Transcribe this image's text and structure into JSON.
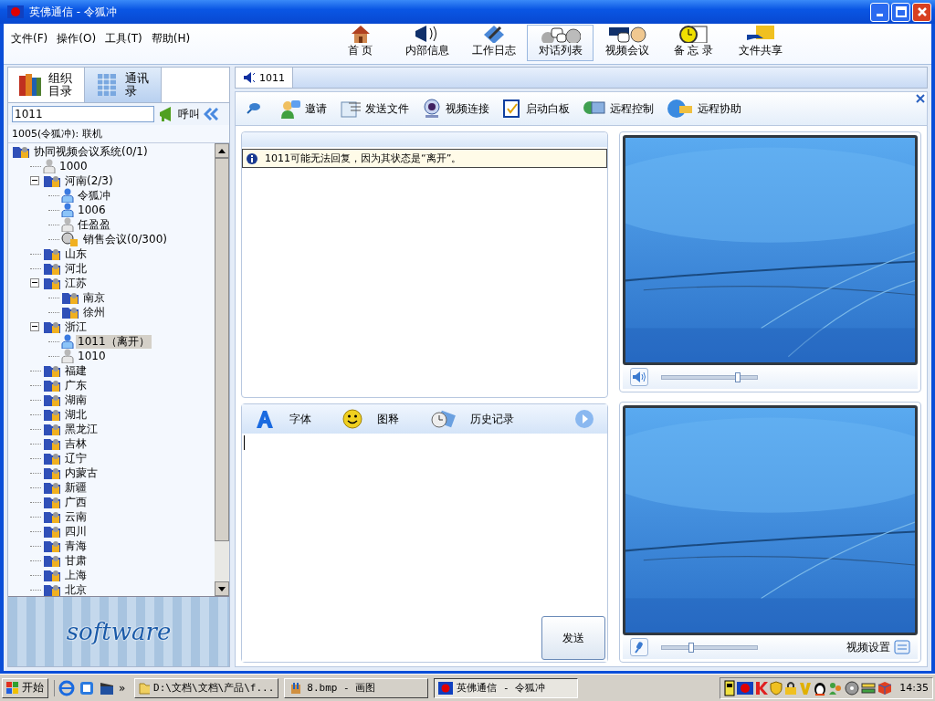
{
  "window": {
    "title": "英佛通信 - 令狐冲"
  },
  "menu": [
    "文件(F)",
    "操作(O)",
    "工具(T)",
    "帮助(H)"
  ],
  "nav": [
    {
      "label": "首 页",
      "selected": false
    },
    {
      "label": "内部信息",
      "selected": false
    },
    {
      "label": "工作日志",
      "selected": false
    },
    {
      "label": "对话列表",
      "selected": true
    },
    {
      "label": "视频会议",
      "selected": false
    },
    {
      "label": "备 忘 录",
      "selected": false
    },
    {
      "label": "文件共享",
      "selected": false
    }
  ],
  "sidebar": {
    "tabs": [
      {
        "label": "组织目录",
        "selected": true
      },
      {
        "label": "通讯录",
        "selected": false
      }
    ],
    "search": {
      "value": "1011"
    },
    "call_button": "呼叫",
    "status": "1005(令狐冲): 联机",
    "logo_text": "software"
  },
  "tree": {
    "items": [
      {
        "kind": "group",
        "label": "协同视频会议系统(0/1)",
        "selected": false,
        "children": [
          {
            "kind": "user",
            "label": "1000",
            "online": false,
            "selected": false
          },
          {
            "kind": "group",
            "label": "河南(2/3)",
            "selected": false,
            "expanded": true,
            "children": [
              {
                "kind": "user",
                "label": "令狐冲",
                "online": true,
                "selected": false
              },
              {
                "kind": "user",
                "label": "1006",
                "online": true,
                "selected": false
              },
              {
                "kind": "user",
                "label": "任盈盈",
                "online": false,
                "selected": false
              },
              {
                "kind": "meeting",
                "label": "销售会议(0/300)",
                "selected": false
              }
            ]
          },
          {
            "kind": "group",
            "label": "山东",
            "selected": false
          },
          {
            "kind": "group",
            "label": "河北",
            "selected": false
          },
          {
            "kind": "group",
            "label": "江苏",
            "selected": false,
            "expanded": true,
            "children": [
              {
                "kind": "group",
                "label": "南京",
                "selected": false
              },
              {
                "kind": "group",
                "label": "徐州",
                "selected": false
              }
            ]
          },
          {
            "kind": "group",
            "label": "浙江",
            "selected": false,
            "expanded": true,
            "children": [
              {
                "kind": "user",
                "label": "1011（离开）",
                "online": true,
                "selected": true
              },
              {
                "kind": "user",
                "label": "1010",
                "online": false,
                "selected": false
              }
            ]
          },
          {
            "kind": "group",
            "label": "福建",
            "selected": false
          },
          {
            "kind": "group",
            "label": "广东",
            "selected": false
          },
          {
            "kind": "group",
            "label": "湖南",
            "selected": false
          },
          {
            "kind": "group",
            "label": "湖北",
            "selected": false
          },
          {
            "kind": "group",
            "label": "黑龙江",
            "selected": false
          },
          {
            "kind": "group",
            "label": "吉林",
            "selected": false
          },
          {
            "kind": "group",
            "label": "辽宁",
            "selected": false
          },
          {
            "kind": "group",
            "label": "内蒙古",
            "selected": false
          },
          {
            "kind": "group",
            "label": "新疆",
            "selected": false
          },
          {
            "kind": "group",
            "label": "广西",
            "selected": false
          },
          {
            "kind": "group",
            "label": "云南",
            "selected": false
          },
          {
            "kind": "group",
            "label": "四川",
            "selected": false
          },
          {
            "kind": "group",
            "label": "青海",
            "selected": false
          },
          {
            "kind": "group",
            "label": "甘肃",
            "selected": false
          },
          {
            "kind": "group",
            "label": "上海",
            "selected": false
          },
          {
            "kind": "group",
            "label": "北京",
            "selected": false
          }
        ]
      }
    ]
  },
  "chat": {
    "tab": "1011",
    "toolbar": [
      "邀请",
      "发送文件",
      "视频连接",
      "启动白板",
      "远程控制",
      "远程协助"
    ],
    "notice": "1011可能无法回复，因为其状态是“离开”。",
    "input_toolbar": [
      "字体",
      "图释",
      "历史记录"
    ],
    "send_button": "发送"
  },
  "video": {
    "remote_volume": {
      "level": 0.8
    },
    "local_mic": {
      "level": 0.31
    },
    "settings_label": "视频设置"
  },
  "taskbar": {
    "start": "开始",
    "more": "»",
    "tasks": [
      {
        "label": "D:\\文档\\文档\\产品\\f...",
        "selected": false
      },
      {
        "label": "8.bmp - 画图",
        "selected": false
      },
      {
        "label": "英佛通信 - 令狐冲",
        "selected": true
      }
    ],
    "clock": "14:35"
  }
}
